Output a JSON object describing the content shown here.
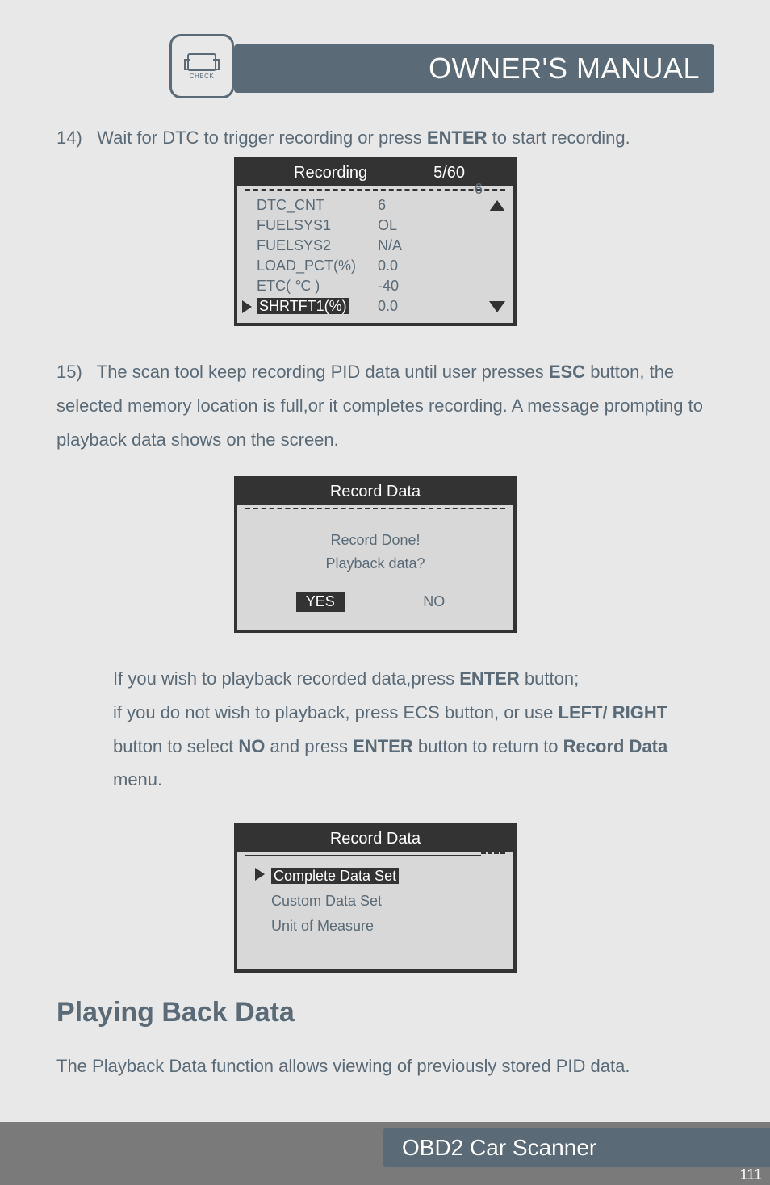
{
  "header": {
    "title": "OWNER'S MANUAL",
    "logo_text": "CHECK"
  },
  "step14": {
    "num": "14)",
    "text_before": "Wait for DTC to trigger recording or press ",
    "bold": "ENTER",
    "text_after": " to start recording."
  },
  "screen1": {
    "title_left": "Recording",
    "title_right": "5/60",
    "badge": "6",
    "rows": [
      {
        "label": "DTC_CNT",
        "value": "6"
      },
      {
        "label": "FUELSYS1",
        "value": "OL"
      },
      {
        "label": "FUELSYS2",
        "value": "N/A"
      },
      {
        "label": "LOAD_PCT(%)",
        "value": "0.0"
      },
      {
        "label": "ETC( ℃ )",
        "value": "-40"
      },
      {
        "label": "SHRTFT1(%)",
        "value": "0.0",
        "highlighted": true
      }
    ]
  },
  "step15": {
    "num": "15)",
    "text1": "The scan tool keep recording PID data until user presses ",
    "bold1": "ESC",
    "text2": " button, the selected memory location is full,or it completes recording. A message prompting to playback data shows on the screen."
  },
  "screen2": {
    "title": "Record Data",
    "msg1": "Record Done!",
    "msg2": "Playback data?",
    "yes": "YES",
    "no": "NO"
  },
  "para_after2": {
    "l1a": "If you wish to playback recorded data,press ",
    "l1b": "ENTER",
    "l1c": " button;",
    "l2a": "if  you do not  wish to playback, press ECS button, or use ",
    "l2b": "LEFT/ RIGHT",
    "l2c": " button to select ",
    "l2d": "NO",
    "l2e": " and press ",
    "l2f": "ENTER",
    "l2g": " button to return to ",
    "l2h": "Record Data",
    "l2i": " menu."
  },
  "screen3": {
    "title": "Record Data",
    "items": [
      {
        "label": "Complete Data Set",
        "selected": true
      },
      {
        "label": "Custom Data Set",
        "selected": false
      },
      {
        "label": "Unit of Measure",
        "selected": false
      }
    ]
  },
  "h2": "Playing Back Data",
  "para_pb": "The Playback Data function allows viewing of previously stored PID data.",
  "footer": {
    "text": "OBD2 Car Scanner",
    "page": "111"
  }
}
